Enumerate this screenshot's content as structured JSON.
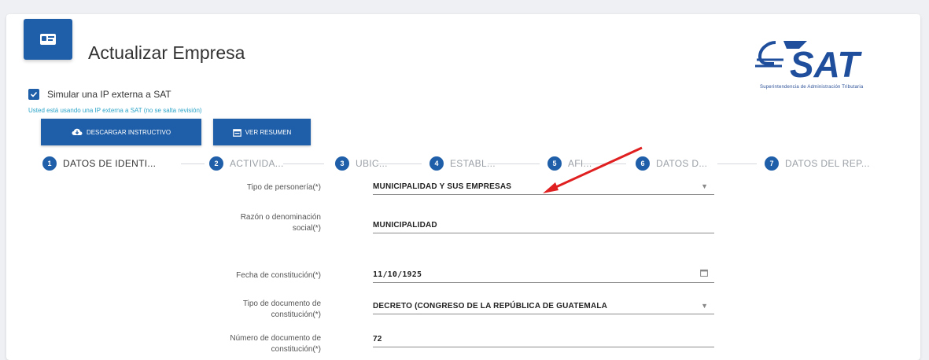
{
  "header": {
    "title": "Actualizar Empresa",
    "icon": "id-card-icon"
  },
  "logo": {
    "text": "SAT",
    "subtitle": "Superintendencia de Administración Tributaria",
    "color": "#1f4e9c"
  },
  "simulate": {
    "label": "Simular una IP externa a SAT",
    "checked": true,
    "note": "Usted está usando una IP externa a SAT (no se salta revisión)"
  },
  "buttons": {
    "descargar": "DESCARGAR INSTRUCTIVO",
    "resumen": "VER RESUMEN"
  },
  "steps": [
    {
      "num": "1",
      "label": "DATOS DE IDENTI..."
    },
    {
      "num": "2",
      "label": "ACTIVIDA..."
    },
    {
      "num": "3",
      "label": "UBIC..."
    },
    {
      "num": "4",
      "label": "ESTABL..."
    },
    {
      "num": "5",
      "label": "AFI..."
    },
    {
      "num": "6",
      "label": "DATOS D..."
    },
    {
      "num": "7",
      "label": "DATOS DEL REP..."
    }
  ],
  "form": {
    "tipo_personeria": {
      "label": "Tipo de personería(*)",
      "value": "MUNICIPALIDAD Y SUS EMPRESAS"
    },
    "razon_social": {
      "label": "Razón o denominación social(*)",
      "value": "MUNICIPALIDAD"
    },
    "fecha_constitucion": {
      "label": "Fecha de constitución(*)",
      "value": "11/10/1925"
    },
    "tipo_documento": {
      "label": "Tipo de documento de constitución(*)",
      "value": "DECRETO (CONGRESO DE LA REPÚBLICA DE GUATEMALA"
    },
    "numero_documento": {
      "label": "Número de documento de constitución(*)",
      "value": "72"
    }
  },
  "colors": {
    "primary": "#1f5ea8",
    "accent_text": "#2aa4c9",
    "arrow": "#e02020"
  }
}
